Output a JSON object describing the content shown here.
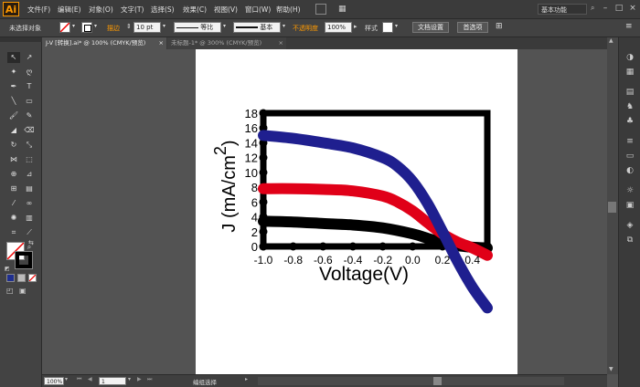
{
  "app": {
    "logo": "Ai"
  },
  "menu": [
    "文件(F)",
    "编辑(E)",
    "对象(O)",
    "文字(T)",
    "选择(S)",
    "效果(C)",
    "视图(V)",
    "窗口(W)",
    "帮助(H)"
  ],
  "workspace": "基本功能",
  "control": {
    "selection": "未选择对象",
    "stroke_label": "描边",
    "stroke_value": "10 pt",
    "profile": "等比",
    "brush": "基本",
    "opacity_label": "不透明度",
    "opacity_value": "100%",
    "style_label": "样式",
    "doc_setup": "文档设置",
    "prefs": "首选项"
  },
  "tabs": [
    {
      "label": "J-V [转换].ai* @ 100% (CMYK/预览)"
    },
    {
      "label": "未标题-1* @ 300% (CMYK/预览)"
    }
  ],
  "status": {
    "zoom": "100%",
    "page": "1",
    "message": "编组选择"
  },
  "colors": {
    "red": "#e00018",
    "blue": "#1f1f8f",
    "black": "#000000"
  },
  "chart_data": {
    "type": "line",
    "xlabel": "Voltage(V)",
    "ylabel": "J (mA/cm 2)",
    "ylabel_main": "J (mA/cm",
    "ylabel_sup": "2",
    "ylabel_close": ")",
    "xlim": [
      -1.0,
      0.5
    ],
    "ylim": [
      0,
      18
    ],
    "xticks": [
      "-1.0",
      "-0.8",
      "-0.6",
      "-0.4",
      "-0.2",
      "0.0",
      "0.2",
      "0.4"
    ],
    "yticks": [
      "0",
      "2",
      "4",
      "6",
      "8",
      "10",
      "12",
      "14",
      "16",
      "18"
    ],
    "series": [
      {
        "color": "#1f1f8f",
        "x": [
          -1.0,
          -0.8,
          -0.6,
          -0.4,
          -0.2,
          -0.1,
          0.0,
          0.1,
          0.2,
          0.3,
          0.4,
          0.5
        ],
        "y": [
          15.0,
          14.6,
          14.0,
          13.3,
          12.0,
          10.8,
          8.8,
          5.8,
          2.0,
          -2.0,
          -5.5,
          -8.3
        ]
      },
      {
        "color": "#e00018",
        "x": [
          -1.0,
          -0.8,
          -0.6,
          -0.4,
          -0.2,
          -0.1,
          0.0,
          0.1,
          0.2,
          0.3,
          0.4,
          0.5
        ],
        "y": [
          7.8,
          7.8,
          7.7,
          7.5,
          6.8,
          6.0,
          4.8,
          3.2,
          1.7,
          0.6,
          -0.2,
          -1.2
        ]
      },
      {
        "color": "#000000",
        "x": [
          -1.0,
          -0.8,
          -0.6,
          -0.4,
          -0.2,
          0.0,
          0.1,
          0.2,
          0.3,
          0.4,
          0.5
        ],
        "y": [
          3.4,
          3.3,
          3.1,
          2.9,
          2.5,
          1.7,
          1.1,
          0.5,
          0.1,
          -0.1,
          -0.2
        ]
      }
    ]
  }
}
